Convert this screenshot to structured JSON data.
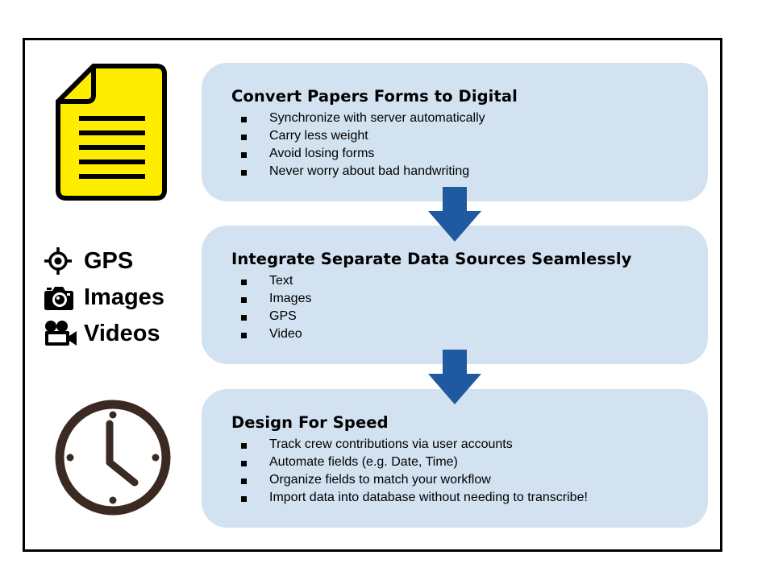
{
  "panels": [
    {
      "title": "Convert Papers Forms to Digital",
      "items": [
        "Synchronize with server automatically",
        "Carry less weight",
        "Avoid losing forms",
        "Never worry about bad handwriting"
      ]
    },
    {
      "title": "Integrate Separate Data Sources Seamlessly",
      "items": [
        "Text",
        "Images",
        "GPS",
        "Video"
      ]
    },
    {
      "title": "Design For Speed",
      "items": [
        "Track crew contributions via user accounts",
        "Automate fields (e.g. Date, Time)",
        "Organize fields to match your workflow",
        "Import data into database without needing to transcribe!"
      ]
    }
  ],
  "features": [
    {
      "label": "GPS",
      "icon": "gps-crosshair-icon"
    },
    {
      "label": "Images",
      "icon": "camera-icon"
    },
    {
      "label": "Videos",
      "icon": "video-camera-icon"
    }
  ],
  "icons": {
    "document": "document-icon",
    "clock": "clock-icon"
  },
  "colors": {
    "panel": "#d2e2f1",
    "arrow": "#1f5aa0",
    "document": "#ffed00",
    "clock": "#3b2a22"
  }
}
